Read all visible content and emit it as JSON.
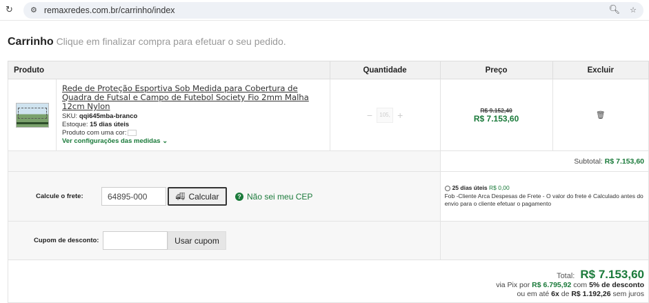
{
  "browser": {
    "url": "remaxredes.com.br/carrinho/index"
  },
  "heading": {
    "title": "Carrinho",
    "subtitle": "Clique em finalizar compra para efetuar o seu pedido."
  },
  "table": {
    "headers": {
      "produto": "Produto",
      "quantidade": "Quantidade",
      "preco": "Preço",
      "excluir": "Excluir"
    }
  },
  "product": {
    "name": "Rede de Proteção Esportiva Sob Medida para Cobertura de Quadra de Futsal e Campo de Futebol Society Fio 2mm Malha 12cm Nylon",
    "sku_label": "SKU:",
    "sku": "qqi645mba-branco",
    "stock_label": "Estoque:",
    "stock": "15 dias úteis",
    "color_label": "Produto com uma cor:",
    "config_link": "Ver configurações das medidas",
    "quantity": "105,",
    "old_price": "R$ 9.152,40",
    "new_price": "R$ 7.153,60"
  },
  "subtotal": {
    "label": "Subtotal:",
    "value": "R$ 7.153,60"
  },
  "frete": {
    "label": "Calcule o frete:",
    "cep_value": "64895-000",
    "calc_button": "Calcular",
    "nao_sei": "Não sei meu CEP",
    "option_days": "25 dias úteis",
    "option_price": "R$ 0,00",
    "option_desc": "Fob -Cliente Arca Despesas de Frete - O valor do frete é Calculado antes do envio para o cliente efetuar o pagamento"
  },
  "cupom": {
    "label": "Cupom de desconto:",
    "button": "Usar cupom"
  },
  "total": {
    "label": "Total:",
    "value": "R$ 7.153,60",
    "pix_prefix": "via Pix por",
    "pix_value": "R$ 6.795,92",
    "pix_mid": "com",
    "pix_discount": "5% de desconto",
    "inst_prefix": "ou em até",
    "inst_count": "6x",
    "inst_mid": "de",
    "inst_value": "R$ 1.192,26",
    "inst_suffix": "sem juros"
  },
  "colors": {
    "accent": "#1a7a3a"
  },
  "icons": [
    "reload-icon",
    "site-info-icon",
    "zoom-icon",
    "bookmark-icon",
    "chevron-down-icon",
    "truck-icon",
    "help-icon",
    "trash-icon"
  ]
}
